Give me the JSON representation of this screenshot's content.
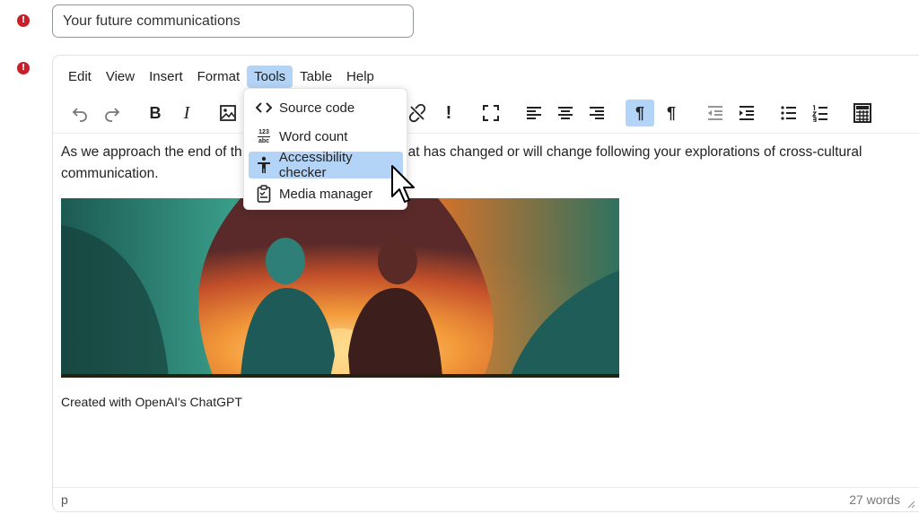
{
  "title_field": {
    "value": "Your future communications"
  },
  "error_icon": "!",
  "menubar": {
    "items": [
      "Edit",
      "View",
      "Insert",
      "Format",
      "Tools",
      "Table",
      "Help"
    ],
    "active": "Tools"
  },
  "toolbar": {
    "bold_label": "B",
    "italic_label": "I",
    "exclaim_label": "!",
    "ltr_label": "¶",
    "rtl_label": "¶"
  },
  "tools_menu": {
    "items": [
      {
        "label": "Source code",
        "icon": "code-icon"
      },
      {
        "label": "Word count",
        "icon": "word-count-icon",
        "icon_text_top": "123",
        "icon_text_bottom": "abc"
      },
      {
        "label": "Accessibility checker",
        "icon": "accessibility-icon"
      },
      {
        "label": "Media manager",
        "icon": "clipboard-icon"
      }
    ],
    "highlighted": "Accessibility checker"
  },
  "content": {
    "paragraph_visible_left": "As we approach the end of th",
    "paragraph_visible_right": "at has changed or will change following your explorations of cross-cultural",
    "paragraph_line2": "communication.",
    "caption": "Created with OpenAI's ChatGPT"
  },
  "statusbar": {
    "path": "p",
    "word_count": "27 words"
  },
  "colors": {
    "accent": "#b4d4f7",
    "error": "#c8202a"
  }
}
